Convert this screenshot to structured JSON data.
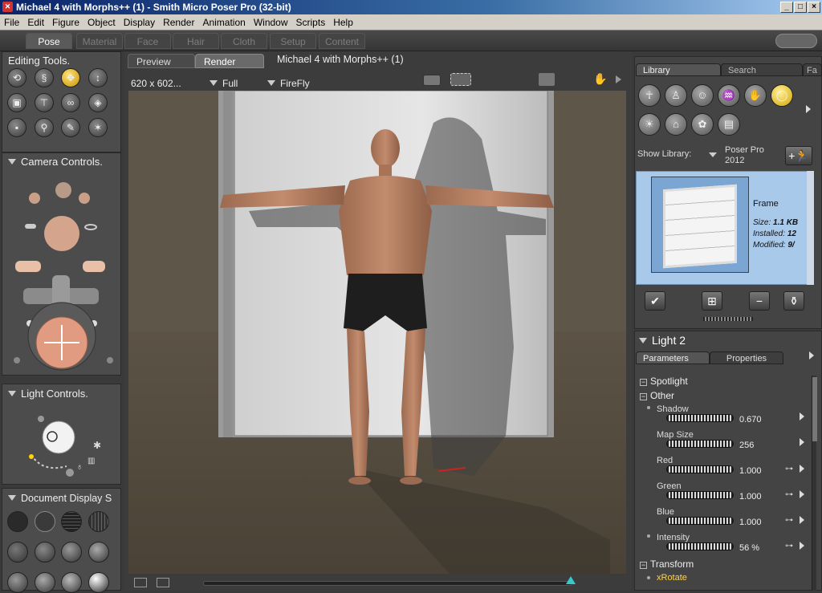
{
  "window": {
    "title": "Michael 4 with Morphs++ (1) - Smith Micro Poser Pro  (32-bit)",
    "min": "_",
    "max": "□",
    "close": "×"
  },
  "menu": [
    "File",
    "Edit",
    "Figure",
    "Object",
    "Display",
    "Render",
    "Animation",
    "Window",
    "Scripts",
    "Help"
  ],
  "rooms": [
    "Pose",
    "Material",
    "Face",
    "Hair",
    "Cloth",
    "Setup",
    "Content"
  ],
  "editing_tools": {
    "title": "Editing Tools."
  },
  "camera_controls": {
    "title": "Camera Controls."
  },
  "light_controls": {
    "title": "Light Controls."
  },
  "document_display": {
    "title": "Document Display S"
  },
  "viewport": {
    "tabs": [
      "Preview",
      "Render"
    ],
    "document_title": "Michael 4 with Morphs++ (1)",
    "size_label": "620 x 602...",
    "area_option": "Full",
    "renderer": "FireFly"
  },
  "library": {
    "tabs": [
      "Library",
      "Search",
      "Fa"
    ],
    "show_library_label": "Show Library:",
    "library_name_line1": "Poser Pro",
    "library_name_line2": "2012",
    "item": {
      "name": "Frame",
      "size_label": "Size:",
      "size_value": "1.1 KB",
      "installed_label": "Installed:",
      "installed_value": "12",
      "modified_label": "Modified:",
      "modified_value": "9/"
    }
  },
  "properties": {
    "title": "Light 2",
    "tabs": [
      "Parameters",
      "Properties"
    ],
    "groups": {
      "spotlight": "Spotlight",
      "other": "Other",
      "transform": "Transform"
    },
    "params": [
      {
        "name": "Shadow",
        "value": "0.670"
      },
      {
        "name": "Map Size",
        "value": "256"
      },
      {
        "name": "Red",
        "value": "1.000"
      },
      {
        "name": "Green",
        "value": "1.000"
      },
      {
        "name": "Blue",
        "value": "1.000"
      },
      {
        "name": "Intensity",
        "value": "56 %"
      }
    ],
    "next_param": "xRotate"
  }
}
